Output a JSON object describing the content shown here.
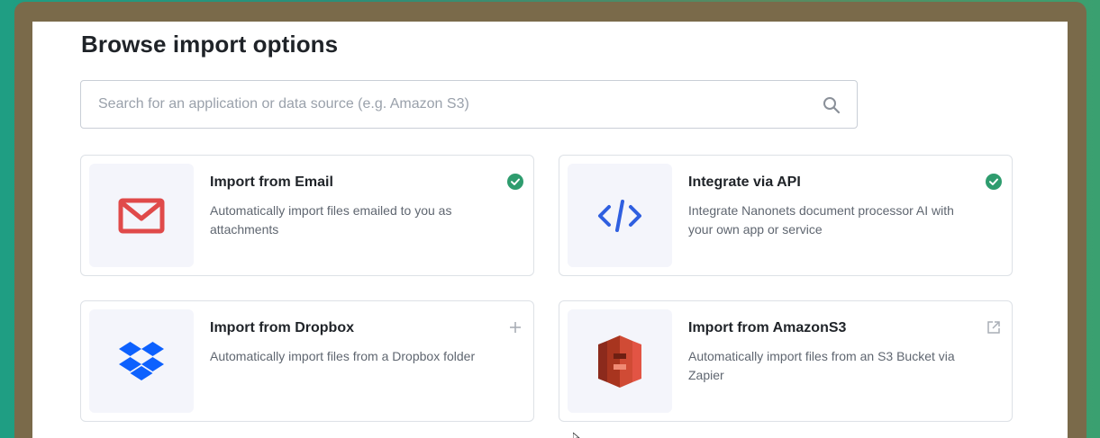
{
  "page": {
    "title": "Browse import options"
  },
  "search": {
    "placeholder": "Search for an application or data source (e.g. Amazon S3)",
    "value": ""
  },
  "cards": [
    {
      "title": "Import from Email",
      "description": "Automatically import files emailed to you as attachments",
      "icon": "gmail-icon",
      "status": "enabled-check-icon"
    },
    {
      "title": "Integrate via API",
      "description": "Integrate Nanonets document processor AI with your own app or service",
      "icon": "code-brackets-icon",
      "status": "enabled-check-icon"
    },
    {
      "title": "Import from Dropbox",
      "description": "Automatically import files from a Dropbox folder",
      "icon": "dropbox-icon",
      "status": "add-plus-icon"
    },
    {
      "title": "Import from AmazonS3",
      "description": "Automatically import files from an S3 Bucket via Zapier",
      "icon": "amazon-s3-icon",
      "status": "external-link-icon"
    }
  ],
  "colors": {
    "check_green": "#2e9c6e",
    "gmail_red": "#e04a4a",
    "api_blue": "#2f5fe0",
    "dropbox_blue": "#0d61fe",
    "s3_red": "#c7432f",
    "frame_brown": "#7a6a4a"
  }
}
